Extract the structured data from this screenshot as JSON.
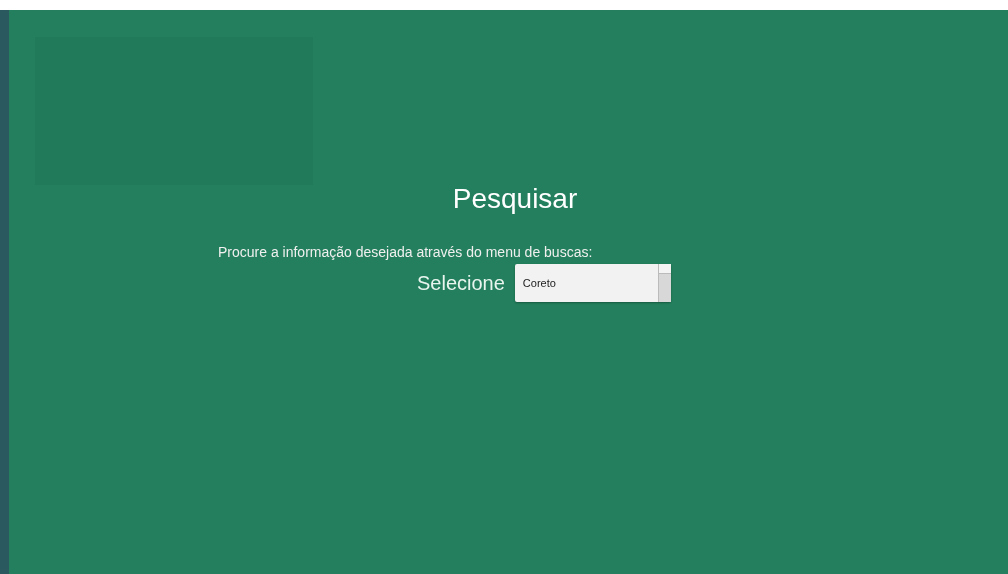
{
  "title": "Pesquisar",
  "instruction": "Procure a informação desejada através do menu de buscas:",
  "select": {
    "label": "Selecione",
    "value": "Coreto"
  }
}
